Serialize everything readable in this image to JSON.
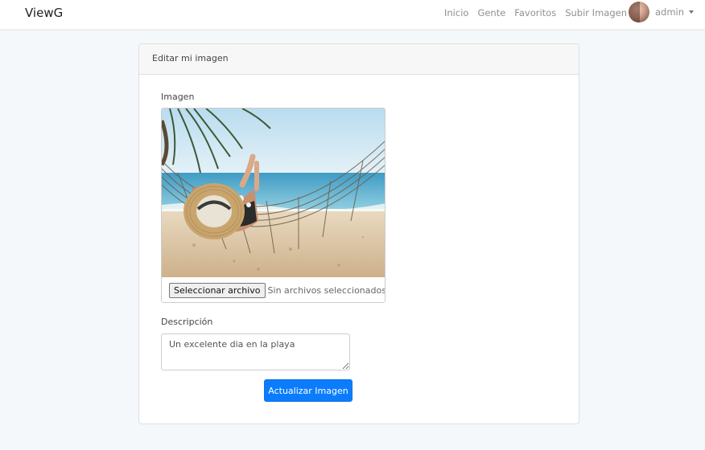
{
  "navbar": {
    "brand": "ViewG",
    "links": [
      "Inicio",
      "Gente",
      "Favoritos",
      "Subir Imagen"
    ],
    "user": {
      "name": "admin"
    }
  },
  "card": {
    "header": "Editar mi imagen",
    "image_label": "Imagen",
    "file_button": "Seleccionar archivo",
    "file_status": "Sin archivos seleccionados",
    "description_label": "Descripción",
    "description_value": "Un excelente dia en la playa",
    "submit_label": "Actualizar Imagen"
  },
  "colors": {
    "primary": "#0b7dfc",
    "background": "#f5f8fa",
    "nav_link": "#8c9196"
  }
}
